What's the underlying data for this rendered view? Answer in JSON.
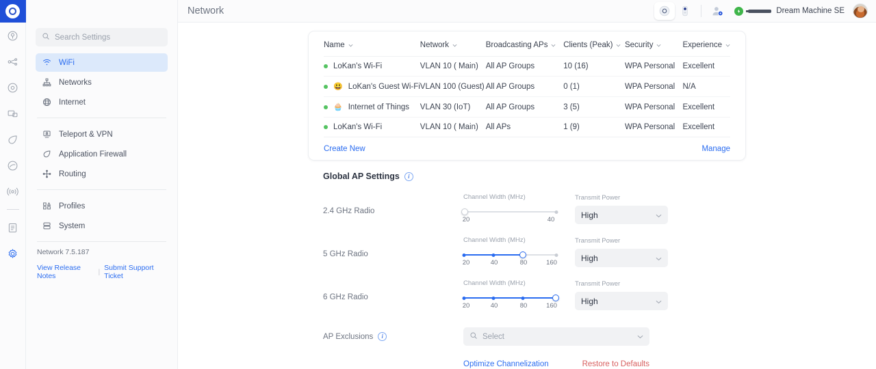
{
  "rail": {
    "logo_name": "unifi-logo",
    "items": [
      {
        "name": "sidebar-app-protect",
        "icon": "protect-icon"
      },
      {
        "name": "sidebar-app-network-topology",
        "icon": "network-topology-icon"
      },
      {
        "name": "sidebar-app-access",
        "icon": "access-icon"
      },
      {
        "name": "sidebar-app-devices",
        "icon": "devices-icon"
      },
      {
        "name": "sidebar-app-innerspace",
        "icon": "shield-icon"
      },
      {
        "name": "sidebar-app-talk",
        "icon": "talk-icon"
      },
      {
        "name": "sidebar-app-connect",
        "icon": "broadcast-icon"
      },
      {
        "name": "sidebar-app-logs",
        "icon": "clipboard-icon"
      },
      {
        "name": "sidebar-app-settings",
        "icon": "gear-icon"
      }
    ]
  },
  "header": {
    "title": "Network",
    "console_name": "Dream Machine SE",
    "devices": [
      "access-point-device-icon",
      "doorbell-device-icon"
    ],
    "user_gear": "user-settings-icon",
    "avatar": "user-avatar"
  },
  "sidebar": {
    "search": {
      "placeholder": "Search Settings",
      "icon": "search-icon"
    },
    "groups": [
      {
        "items": [
          {
            "label": "WiFi",
            "icon": "wifi-icon",
            "active": true
          },
          {
            "label": "Networks",
            "icon": "networks-icon",
            "active": false
          },
          {
            "label": "Internet",
            "icon": "globe-icon",
            "active": false
          }
        ]
      },
      {
        "items": [
          {
            "label": "Teleport & VPN",
            "icon": "teleport-icon",
            "active": false
          },
          {
            "label": "Application Firewall",
            "icon": "firewall-shield-icon",
            "active": false
          },
          {
            "label": "Routing",
            "icon": "routing-icon",
            "active": false
          }
        ]
      },
      {
        "items": [
          {
            "label": "Profiles",
            "icon": "profiles-icon",
            "active": false
          },
          {
            "label": "System",
            "icon": "system-icon",
            "active": false
          }
        ]
      }
    ],
    "version": "Network 7.5.187",
    "footer_links": [
      {
        "label": "View Release Notes"
      },
      {
        "label": "Submit Support Ticket"
      }
    ],
    "footer_separator": "|"
  },
  "wifi_table": {
    "columns": [
      {
        "label": "Name",
        "sort_icon": "chevron-down-icon"
      },
      {
        "label": "Network",
        "sort_icon": "chevron-down-icon"
      },
      {
        "label": "Broadcasting APs",
        "sort_icon": "chevron-down-icon"
      },
      {
        "label": "Clients (Peak)",
        "sort_icon": "chevron-down-icon"
      },
      {
        "label": "Security",
        "sort_icon": "chevron-down-icon"
      },
      {
        "label": "Experience",
        "sort_icon": "chevron-down-icon"
      }
    ],
    "rows": [
      {
        "status": "online",
        "emoji": "",
        "name": "LoKan's Wi-Fi",
        "network": "VLAN 10 ( Main)",
        "aps": "All AP Groups",
        "clients": "10 (16)",
        "security": "WPA Personal",
        "experience": "Excellent",
        "experience_state": "good"
      },
      {
        "status": "online",
        "emoji": "😃",
        "name": "LoKan's Guest Wi-Fi",
        "network": "VLAN 100 (Guest)",
        "aps": "All AP Groups",
        "clients": "0 (1)",
        "security": "WPA Personal",
        "experience": "N/A",
        "experience_state": "na"
      },
      {
        "status": "online",
        "emoji": "🧁",
        "name": "Internet of Things",
        "network": "VLAN 30 (IoT)",
        "aps": "All AP Groups",
        "clients": "3 (5)",
        "security": "WPA Personal",
        "experience": "Excellent",
        "experience_state": "good"
      },
      {
        "status": "online",
        "emoji": "",
        "name": "LoKan's Wi-Fi",
        "network": "VLAN 10 ( Main)",
        "aps": "All APs",
        "clients": "1 (9)",
        "security": "WPA Personal",
        "experience": "Excellent",
        "experience_state": "good"
      }
    ],
    "create_new": "Create New",
    "manage": "Manage"
  },
  "global_ap": {
    "title": "Global AP Settings",
    "info_icon": "info-icon",
    "channel_width_label": "Channel Width (MHz)",
    "transmit_power_label": "Transmit Power",
    "radios": [
      {
        "label": "2.4 GHz Radio",
        "ticks": [
          "20",
          "40"
        ],
        "selected_index": 0,
        "transmit_power": "High"
      },
      {
        "label": "5 GHz Radio",
        "ticks": [
          "20",
          "40",
          "80",
          "160"
        ],
        "selected_index": 2,
        "transmit_power": "High"
      },
      {
        "label": "6 GHz Radio",
        "ticks": [
          "20",
          "40",
          "80",
          "160"
        ],
        "selected_index": 3,
        "transmit_power": "High"
      }
    ],
    "ap_exclusions": {
      "label": "AP Exclusions",
      "info_icon": "info-icon",
      "placeholder": "Select",
      "search_icon": "search-icon",
      "chevron": "chevron-down-icon"
    },
    "optimize_label": "Optimize Channelization",
    "restore_label": "Restore to Defaults"
  },
  "colors": {
    "accent": "#2a6cf0",
    "brand": "#1f4fd8",
    "status_online": "#55c362",
    "experience_good": "#7dc98a",
    "danger": "#d86060"
  }
}
